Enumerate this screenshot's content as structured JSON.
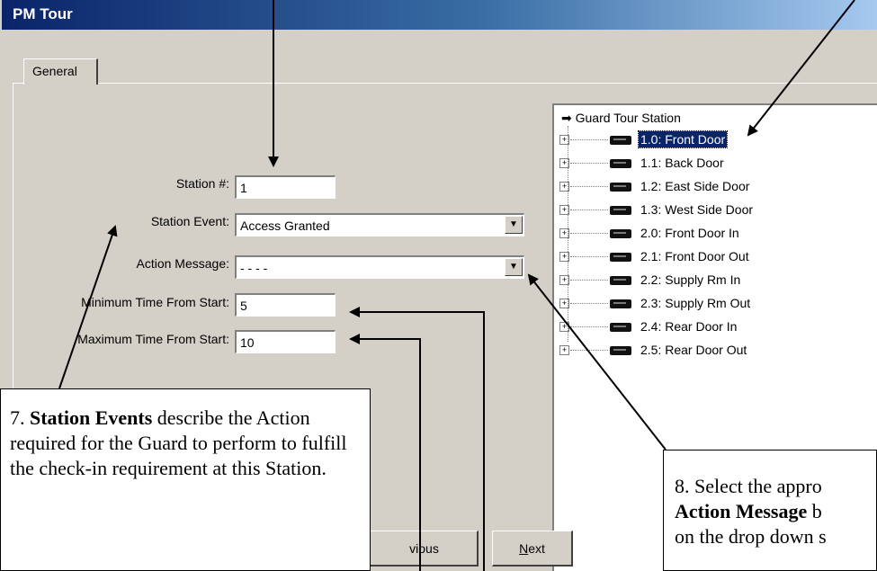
{
  "window": {
    "title": "PM Tour"
  },
  "tabs": [
    {
      "label": "General"
    }
  ],
  "form": {
    "station_num_label": "Station #:",
    "station_num_value": "1",
    "station_event_label": "Station Event:",
    "station_event_value": "Access Granted",
    "action_message_label": "Action Message:",
    "action_message_value": "- - - -",
    "min_time_label": "Minimum Time From Start:",
    "min_time_value": "5",
    "max_time_label": "Maximum Time From Start:",
    "max_time_value": "10"
  },
  "tree": {
    "root": "Guard Tour Station",
    "items": [
      {
        "label": "1.0: Front Door",
        "selected": true
      },
      {
        "label": "1.1: Back Door"
      },
      {
        "label": "1.2: East Side Door"
      },
      {
        "label": "1.3: West Side Door"
      },
      {
        "label": "2.0: Front Door In"
      },
      {
        "label": "2.1: Front Door Out"
      },
      {
        "label": "2.2: Supply Rm In"
      },
      {
        "label": "2.3: Supply Rm Out"
      },
      {
        "label": "2.4: Rear Door In"
      },
      {
        "label": "2.5: Rear Door Out"
      }
    ]
  },
  "buttons": {
    "previous": "vious",
    "next_prefix": "N",
    "next_rest": "ext"
  },
  "callouts": {
    "left": {
      "num": "7.",
      "bold": "Station Events",
      "rest": "describe the Action required for the Guard to perform to fulfill the check-in requirement at this Station."
    },
    "right": {
      "line1": "8. Select the appro",
      "bold": "Action Message",
      "line2_rest": " b",
      "line3": "on the drop down s"
    }
  },
  "icons": {
    "combo_arrow": "dropdown-arrow-icon",
    "tree_root": "arrow-right-icon",
    "reader": "card-reader-icon"
  }
}
